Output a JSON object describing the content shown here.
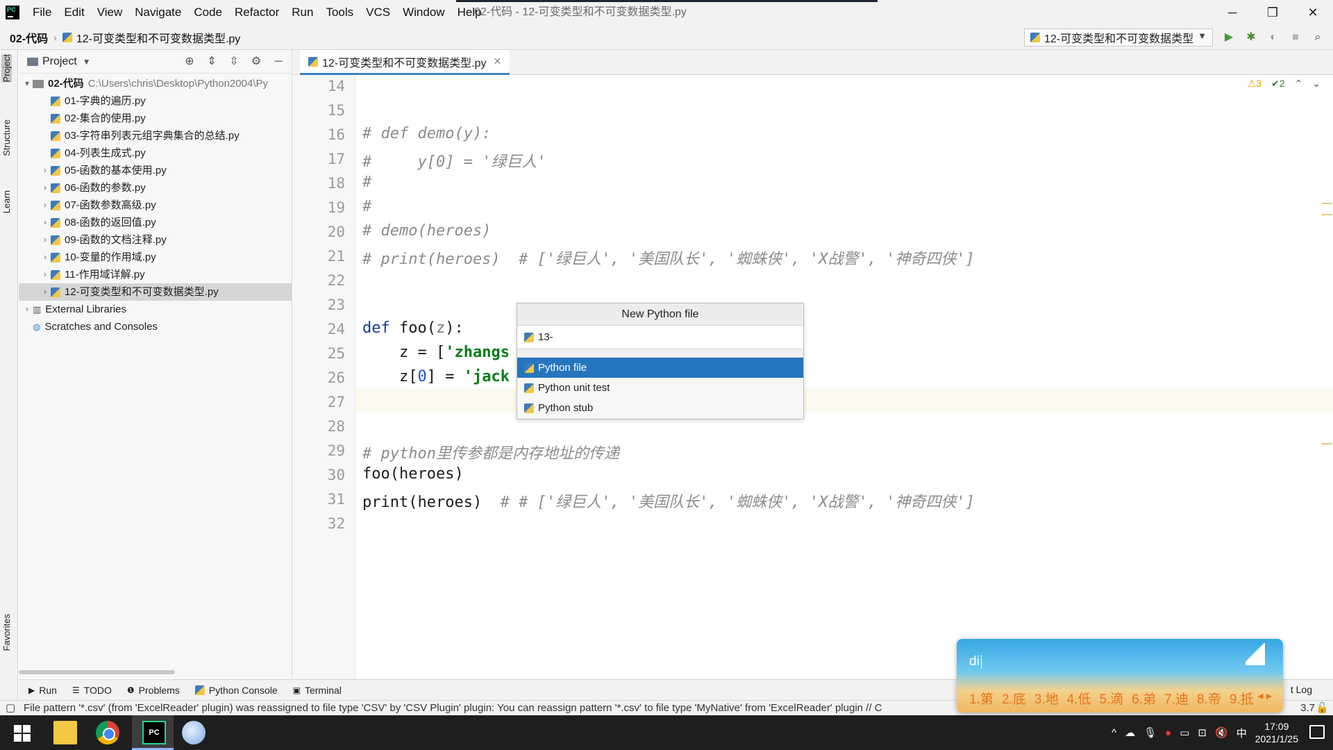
{
  "titlebar": {
    "menu": [
      "File",
      "Edit",
      "View",
      "Navigate",
      "Code",
      "Refactor",
      "Run",
      "Tools",
      "VCS",
      "Window",
      "Help"
    ],
    "title": "02-代码 - 12-可变类型和不可变数据类型.py",
    "minimize": "─",
    "maximize": "❐",
    "close": "✕"
  },
  "navbar": {
    "root": "02-代码",
    "file": "12-可变类型和不可变数据类型.py",
    "run_config": "12-可变类型和不可变数据类型",
    "tools": [
      "run-icon",
      "debug-icon",
      "coverage-icon",
      "stop-icon",
      "search-icon"
    ]
  },
  "left_strip": {
    "tabs": [
      "Project",
      "Structure",
      "Learn",
      "Favorites"
    ]
  },
  "project": {
    "header": "Project",
    "root_name": "02-代码",
    "root_path": "C:\\Users\\chris\\Desktop\\Python2004\\Py",
    "files": [
      {
        "name": "01-字典的遍历.py",
        "expandable": false
      },
      {
        "name": "02-集合的使用.py",
        "expandable": false
      },
      {
        "name": "03-字符串列表元组字典集合的总结.py",
        "expandable": false
      },
      {
        "name": "04-列表生成式.py",
        "expandable": false
      },
      {
        "name": "05-函数的基本使用.py",
        "expandable": true
      },
      {
        "name": "06-函数的参数.py",
        "expandable": true
      },
      {
        "name": "07-函数参数高级.py",
        "expandable": true
      },
      {
        "name": "08-函数的返回值.py",
        "expandable": true
      },
      {
        "name": "09-函数的文档注释.py",
        "expandable": true
      },
      {
        "name": "10-变量的作用域.py",
        "expandable": true
      },
      {
        "name": "11-作用域详解.py",
        "expandable": true
      },
      {
        "name": "12-可变类型和不可变数据类型.py",
        "expandable": true,
        "selected": true
      }
    ],
    "external_libraries": "External Libraries",
    "scratches": "Scratches and Consoles"
  },
  "editor": {
    "tab": "12-可变类型和不可变数据类型.py",
    "warnings": "⚠3",
    "checks": "✔2",
    "line_numbers": [
      "14",
      "15",
      "16",
      "17",
      "18",
      "19",
      "20",
      "21",
      "22",
      "23",
      "24",
      "25",
      "26",
      "27",
      "28",
      "29",
      "30",
      "31",
      "32"
    ],
    "lines": {
      "l16": "# def demo(y):",
      "l17": "#     y[0] = '绿巨人'",
      "l18": "#",
      "l19": "#",
      "l20": "# demo(heroes)",
      "l21": "# print(heroes)  # ['绿巨人', '美国队长', '蜘蛛侠', 'X战警', '神奇四侠']",
      "l24_kw": "def",
      "l24_name": " foo(",
      "l24_param": "z",
      "l24_end": "):",
      "l25_pre": "    z = [",
      "l25_str": "'zhangs",
      "l26_pre": "    z[",
      "l26_num": "0",
      "l26_mid": "] = ",
      "l26_str": "'jack",
      "l29": "# python里传参都是内存地址的传递",
      "l30": "foo(heroes)",
      "l31_code": "print(heroes)  ",
      "l31_comment": "# # ['绿巨人', '美国队长', '蜘蛛侠', 'X战警', '神奇四侠']"
    }
  },
  "popup": {
    "title": "New Python file",
    "input_value": "13-",
    "items": [
      "Python file",
      "Python unit test",
      "Python stub"
    ],
    "selected_index": 0
  },
  "bottom_tools": {
    "run": "Run",
    "todo": "TODO",
    "problems": "Problems",
    "console": "Python Console",
    "terminal": "Terminal",
    "event_log": "t Log"
  },
  "statusbar": {
    "message": "File pattern '*.csv' (from 'ExcelReader' plugin) was reassigned to file type 'CSV' by 'CSV Plugin' plugin: You can reassign pattern '*.csv' to file type 'MyNative' from 'ExcelReader' plugin // C",
    "version": "3.7"
  },
  "taskbar": {
    "tray": [
      "^",
      "中"
    ],
    "time": "17:09",
    "date": "2021/1/25"
  },
  "ime": {
    "input": "di",
    "candidates": [
      "1.第",
      "2.底",
      "3.地",
      "4.低",
      "5.滴",
      "6.弟",
      "7.迪",
      "8.帝",
      "9.抵"
    ],
    "next": "◂ ▸"
  }
}
